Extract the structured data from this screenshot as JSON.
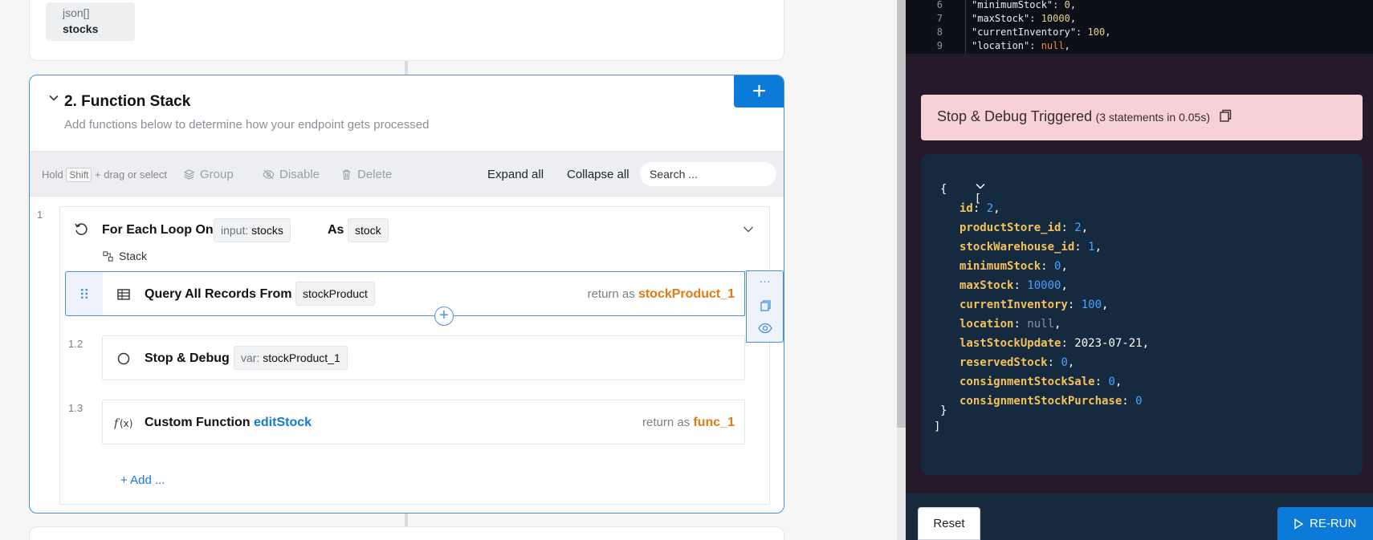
{
  "input_block": {
    "type_label": "json[]",
    "name": "stocks"
  },
  "function_stack": {
    "title": "2. Function Stack",
    "subtitle": "Add functions below to determine how your endpoint gets processed",
    "add_symbol": "+"
  },
  "toolbar": {
    "hold_prefix": "Hold",
    "hold_key": "Shift",
    "hold_suffix": "+ drag or select",
    "group": "Group",
    "disable": "Disable",
    "delete": "Delete",
    "expand_all": "Expand all",
    "collapse_all": "Collapse all",
    "search_placeholder": "Search ..."
  },
  "loop": {
    "step_number": "1",
    "title": "For Each Loop On",
    "input_prefix": "input:",
    "input_value": "stocks",
    "as_label": "As",
    "as_value": "stock",
    "stack_label": "Stack"
  },
  "steps": [
    {
      "number": "",
      "title": "Query All Records From",
      "chip": "stockProduct",
      "return_label": "return as",
      "return_value": "stockProduct_1"
    },
    {
      "number": "1.2",
      "title": "Stop & Debug",
      "chip_prefix": "var:",
      "chip": "stockProduct_1"
    },
    {
      "number": "1.3",
      "title": "Custom Function",
      "link": "editStock",
      "return_label": "return as",
      "return_value": "func_1"
    }
  ],
  "add_label": "+ Add ...",
  "side_actions": {
    "more": "···"
  },
  "code_preview": [
    {
      "ln": "6",
      "key": "\"minimumStock\"",
      "val": "0",
      "kind": "num"
    },
    {
      "ln": "7",
      "key": "\"maxStock\"",
      "val": "10000",
      "kind": "num"
    },
    {
      "ln": "8",
      "key": "\"currentInventory\"",
      "val": "100",
      "kind": "num"
    },
    {
      "ln": "9",
      "key": "\"location\"",
      "val": "null",
      "kind": "null"
    }
  ],
  "debug": {
    "title": "Stop & Debug Triggered",
    "detail": "(3 statements in 0.05s)"
  },
  "json_result": {
    "open_bracket": "[",
    "open_brace": "{",
    "close_brace": "}",
    "close_bracket": "]",
    "fields": [
      {
        "key": "id",
        "value": "2",
        "kind": "num"
      },
      {
        "key": "productStore_id",
        "value": "2",
        "kind": "num"
      },
      {
        "key": "stockWarehouse_id",
        "value": "1",
        "kind": "num"
      },
      {
        "key": "minimumStock",
        "value": "0",
        "kind": "num"
      },
      {
        "key": "maxStock",
        "value": "10000",
        "kind": "num"
      },
      {
        "key": "currentInventory",
        "value": "100",
        "kind": "num"
      },
      {
        "key": "location",
        "value": "null",
        "kind": "null"
      },
      {
        "key": "lastStockUpdate",
        "value": "2023-07-21",
        "kind": "str"
      },
      {
        "key": "reservedStock",
        "value": "0",
        "kind": "num"
      },
      {
        "key": "consignmentStockSale",
        "value": "0",
        "kind": "num"
      },
      {
        "key": "consignmentStockPurchase",
        "value": "0",
        "kind": "num"
      }
    ]
  },
  "footer": {
    "reset": "Reset",
    "rerun": "RE-RUN"
  },
  "colors": {
    "accent": "#0c7ad8",
    "return_value": "#e07a12",
    "json_key": "#f2c25c",
    "json_number": "#4aa3ff",
    "alert_bg": "#f6d2d7"
  }
}
